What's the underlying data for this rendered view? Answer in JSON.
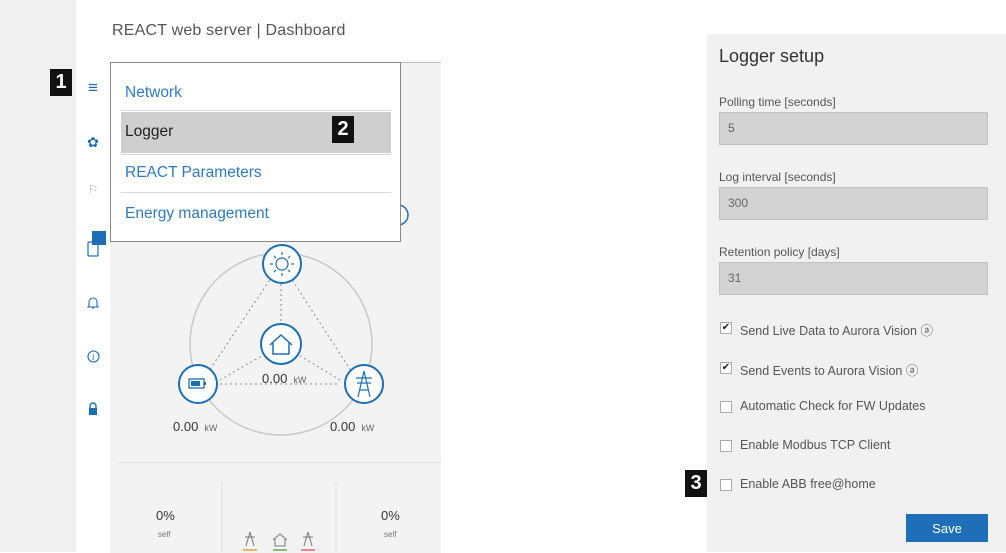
{
  "app": {
    "title": "REACT web server | Dashboard"
  },
  "menu": {
    "items": [
      "Network",
      "Logger",
      "REACT Parameters",
      "Energy management"
    ]
  },
  "badges": [
    "1",
    "2",
    "3"
  ],
  "sidebar": {
    "icons": [
      "menu-icon",
      "gear-icon",
      "flag-icon",
      "device-icon",
      "bell-icon",
      "info-icon",
      "lock-icon"
    ]
  },
  "dashboard": {
    "home_value": "0.00",
    "home_unit": "kW",
    "battery_value": "0.00",
    "battery_unit": "kW",
    "grid_value": "0.00",
    "grid_unit": "kW",
    "self_left": "0%",
    "self_left_label": "self",
    "self_right": "0%",
    "self_right_label": "self"
  },
  "logger": {
    "title": "Logger setup",
    "polling_label": "Polling time [seconds]",
    "polling_value": "5",
    "log_interval_label": "Log interval [seconds]",
    "log_interval_value": "300",
    "retention_label": "Retention policy [days]",
    "retention_value": "31",
    "options": [
      {
        "label": "Send Live Data to Aurora Vision ⓐ",
        "checked": true
      },
      {
        "label": "Send Events to Aurora Vision ⓐ",
        "checked": true
      },
      {
        "label": "Automatic Check for FW Updates",
        "checked": false
      },
      {
        "label": "Enable Modbus TCP Client",
        "checked": false
      },
      {
        "label": "Enable ABB free@home",
        "checked": false
      }
    ],
    "save_label": "Save"
  },
  "colors": {
    "accent": "#1f6fb8",
    "link": "#2f7bbf",
    "panel_bg": "#f1f1f1",
    "input_bg": "#d3d3d3"
  }
}
